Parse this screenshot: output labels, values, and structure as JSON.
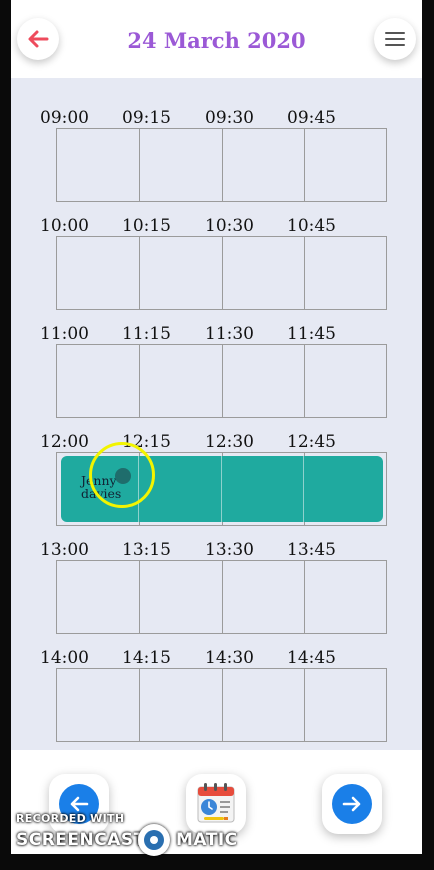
{
  "header": {
    "title": "24 March 2020",
    "back_icon": "back-arrow-icon",
    "menu_icon": "hamburger-menu-icon",
    "accent_color": "#9b59d6"
  },
  "schedule": {
    "hours": [
      {
        "slots": [
          "09:00",
          "09:15",
          "09:30",
          "09:45"
        ]
      },
      {
        "slots": [
          "10:00",
          "10:15",
          "10:30",
          "10:45"
        ]
      },
      {
        "slots": [
          "11:00",
          "11:15",
          "11:30",
          "11:45"
        ]
      },
      {
        "slots": [
          "12:00",
          "12:15",
          "12:30",
          "12:45"
        ]
      },
      {
        "slots": [
          "13:00",
          "13:15",
          "13:30",
          "13:45"
        ]
      },
      {
        "slots": [
          "14:00",
          "14:15",
          "14:30",
          "14:45"
        ]
      }
    ],
    "appointment": {
      "name": "Jenny davies",
      "start": "12:00",
      "end": "13:00",
      "color": "#1faa9f"
    }
  },
  "footer": {
    "prev_icon": "previous-day-arrow-icon",
    "calendar_icon": "calendar-icon",
    "next_icon": "next-day-arrow-icon",
    "button_color": "#1a7fe8"
  },
  "watermark": {
    "line1": "RECORDED WITH",
    "brand_left": "SCREENCAST",
    "brand_right": "MATIC"
  }
}
